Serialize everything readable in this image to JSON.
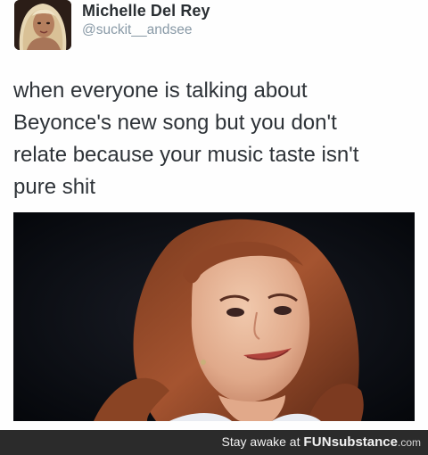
{
  "tweet": {
    "display_name": "Michelle Del Rey",
    "handle": "@suckit__andsee",
    "text": "when everyone is talking about\nBeyonce's new song but you don't\nrelate because your music taste isn't\npure shit"
  },
  "footer": {
    "prefix": "Stay awake at ",
    "brand": "FUN",
    "brand_rest": "substance",
    "tld": ".com"
  },
  "colors": {
    "name": "#2a2f33",
    "handle": "#8899a6",
    "text": "#2e3338",
    "footer_bg": "#2b2b2b"
  }
}
